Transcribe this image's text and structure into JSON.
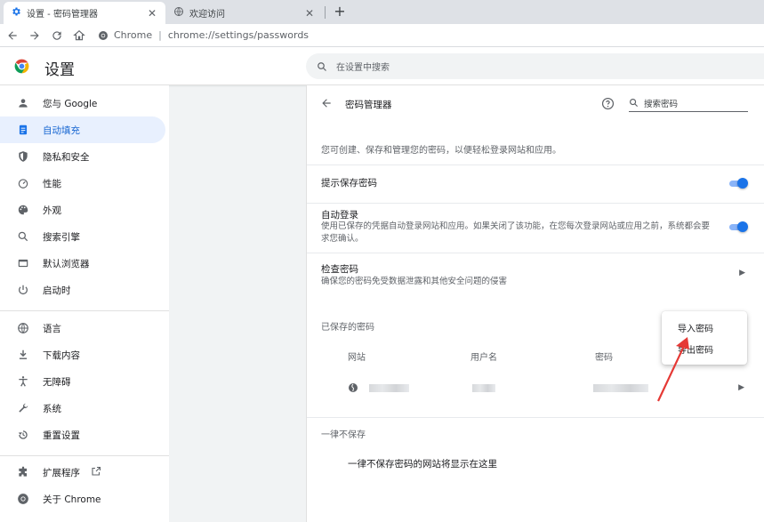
{
  "tabs": [
    {
      "title": "设置 - 密码管理器",
      "active": true
    },
    {
      "title": "欢迎访问",
      "active": false
    }
  ],
  "toolbar": {
    "site_label": "Chrome",
    "separator": "|",
    "url": "chrome://settings/passwords"
  },
  "header": {
    "title": "设置",
    "search_placeholder": "在设置中搜索"
  },
  "sidebar": {
    "items": [
      {
        "label": "您与 Google",
        "icon": "person-icon"
      },
      {
        "label": "自动填充",
        "icon": "clipboard-icon",
        "active": true
      },
      {
        "label": "隐私和安全",
        "icon": "shield-icon"
      },
      {
        "label": "性能",
        "icon": "speedometer-icon"
      },
      {
        "label": "外观",
        "icon": "palette-icon"
      },
      {
        "label": "搜索引擎",
        "icon": "search-icon"
      },
      {
        "label": "默认浏览器",
        "icon": "browser-icon"
      },
      {
        "label": "启动时",
        "icon": "power-icon"
      },
      {
        "label": "语言",
        "icon": "globe-icon"
      },
      {
        "label": "下载内容",
        "icon": "download-icon"
      },
      {
        "label": "无障碍",
        "icon": "accessibility-icon"
      },
      {
        "label": "系统",
        "icon": "wrench-icon"
      },
      {
        "label": "重置设置",
        "icon": "restore-icon"
      },
      {
        "label": "扩展程序",
        "icon": "puzzle-icon"
      },
      {
        "label": "关于 Chrome",
        "icon": "chrome-icon"
      }
    ]
  },
  "main": {
    "title": "密码管理器",
    "search_placeholder": "搜索密码",
    "intro": "您可创建、保存和管理您的密码，以便轻松登录网站和应用。",
    "offer_to_save": {
      "title": "提示保存密码",
      "enabled": true
    },
    "auto_signin": {
      "title": "自动登录",
      "desc": "使用已保存的凭据自动登录网站和应用。如果关闭了该功能，在您每次登录网站或应用之前，系统都会要求您确认。",
      "enabled": true
    },
    "check_passwords": {
      "title": "检查密码",
      "desc": "确保您的密码免受数据泄露和其他安全问题的侵害"
    },
    "saved_passwords": {
      "label": "已保存的密码",
      "columns": [
        "网站",
        "用户名",
        "密码"
      ]
    },
    "never_saved": {
      "label": "一律不保存",
      "empty": "一律不保存密码的网站将显示在这里"
    }
  },
  "menu": {
    "import": "导入密码",
    "export": "导出密码"
  },
  "colors": {
    "accent": "#1a73e8",
    "annotation": "#e53935"
  }
}
